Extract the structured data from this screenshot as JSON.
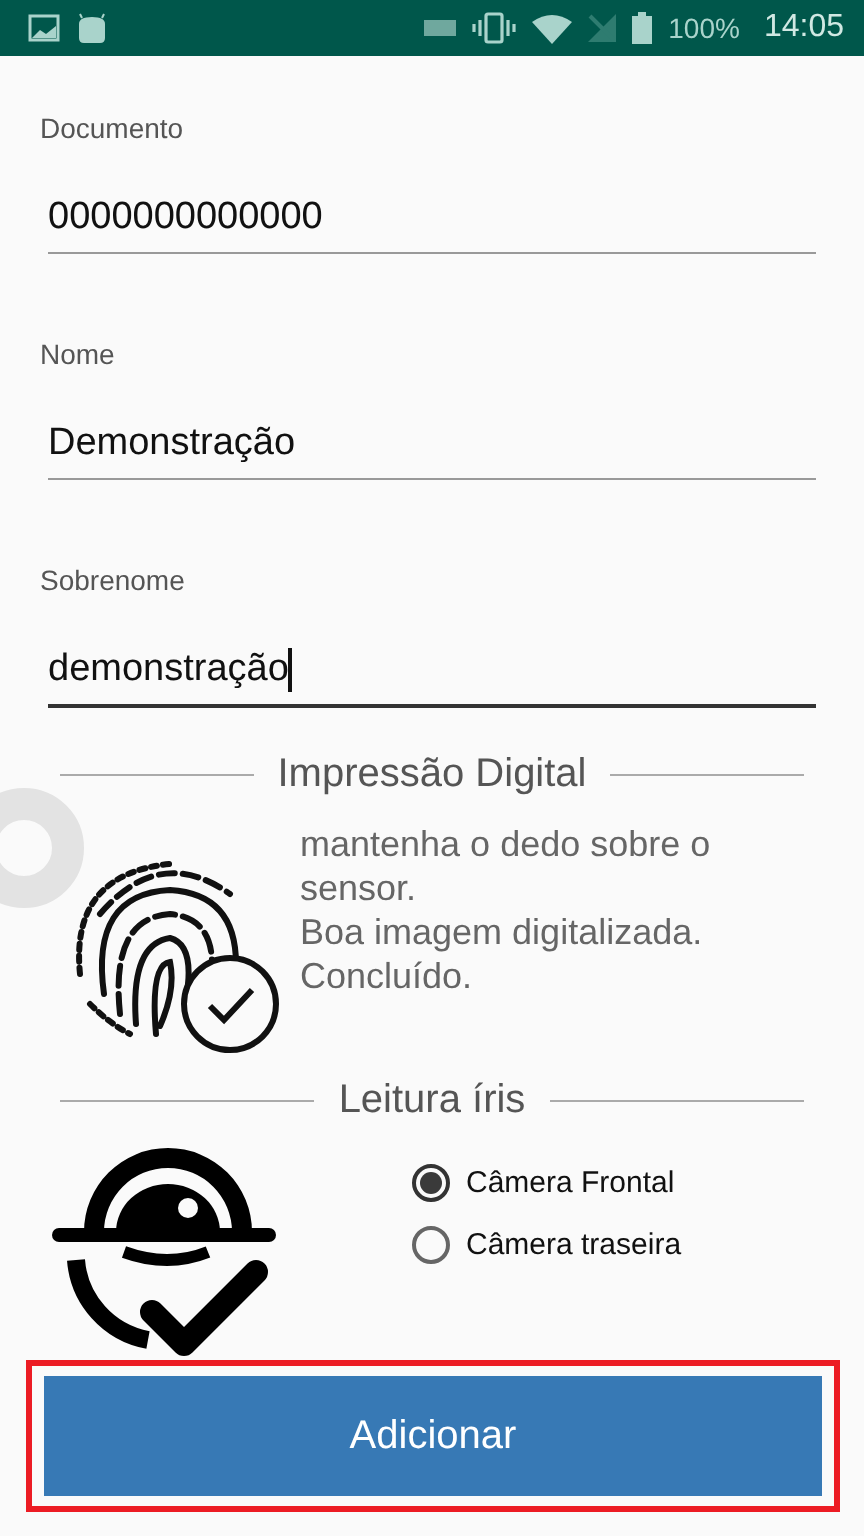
{
  "status_bar": {
    "battery": "100%",
    "time": "14:05"
  },
  "fields": [
    {
      "label": "Documento",
      "value": "0000000000000",
      "focused": false
    },
    {
      "label": "Nome",
      "value": "Demonstração",
      "focused": false
    },
    {
      "label": "Sobrenome",
      "value": "demonstração",
      "focused": true
    }
  ],
  "fingerprint": {
    "title": "Impressão Digital",
    "messages": [
      "mantenha o dedo sobre o sensor.",
      "Boa imagem digitalizada.",
      "Concluído."
    ]
  },
  "iris": {
    "title": "Leitura íris",
    "options": [
      {
        "label": "Câmera Frontal",
        "selected": true
      },
      {
        "label": "Câmera traseira",
        "selected": false
      }
    ]
  },
  "button": {
    "label": "Adicionar",
    "highlighted": true
  }
}
